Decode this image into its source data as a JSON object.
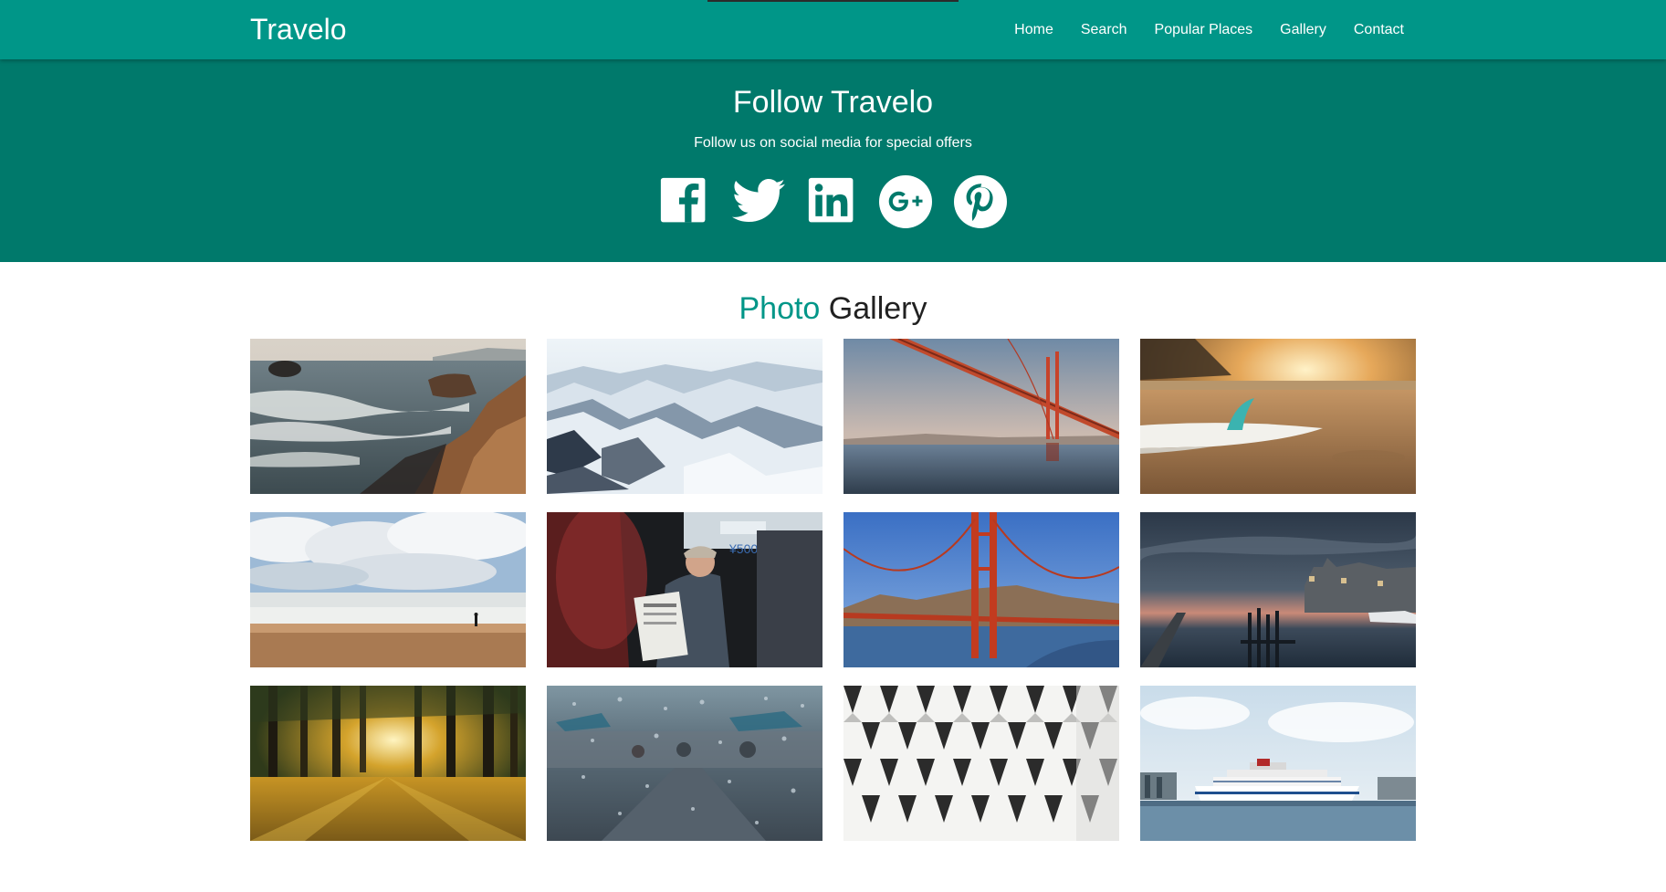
{
  "nav": {
    "brand": "Travelo",
    "links": [
      "Home",
      "Search",
      "Popular Places",
      "Gallery",
      "Contact"
    ]
  },
  "follow": {
    "title": "Follow Travelo",
    "subtitle": "Follow us on social media for special offers",
    "icons": [
      "facebook-icon",
      "twitter-icon",
      "linkedin-icon",
      "google-plus-icon",
      "pinterest-icon"
    ]
  },
  "gallery": {
    "title_accent": "Photo",
    "title_rest": "Gallery",
    "photos": [
      "rocky-coast-waves-photo",
      "snowy-mountains-photo",
      "suspension-bridge-underside-photo",
      "surfboard-on-beach-sunset-photo",
      "cloudy-beach-person-photo",
      "man-reading-newspaper-on-train-photo",
      "golden-gate-bridge-photo",
      "harbor-pier-dusk-photo",
      "sunlit-forest-photo",
      "rainy-window-street-photo",
      "white-geometric-facade-photo",
      "cruise-ship-port-photo"
    ]
  },
  "colors": {
    "nav": "#009688",
    "follow_band": "#00796b",
    "accent": "#009688",
    "text_dark": "#212121",
    "white": "#ffffff"
  }
}
